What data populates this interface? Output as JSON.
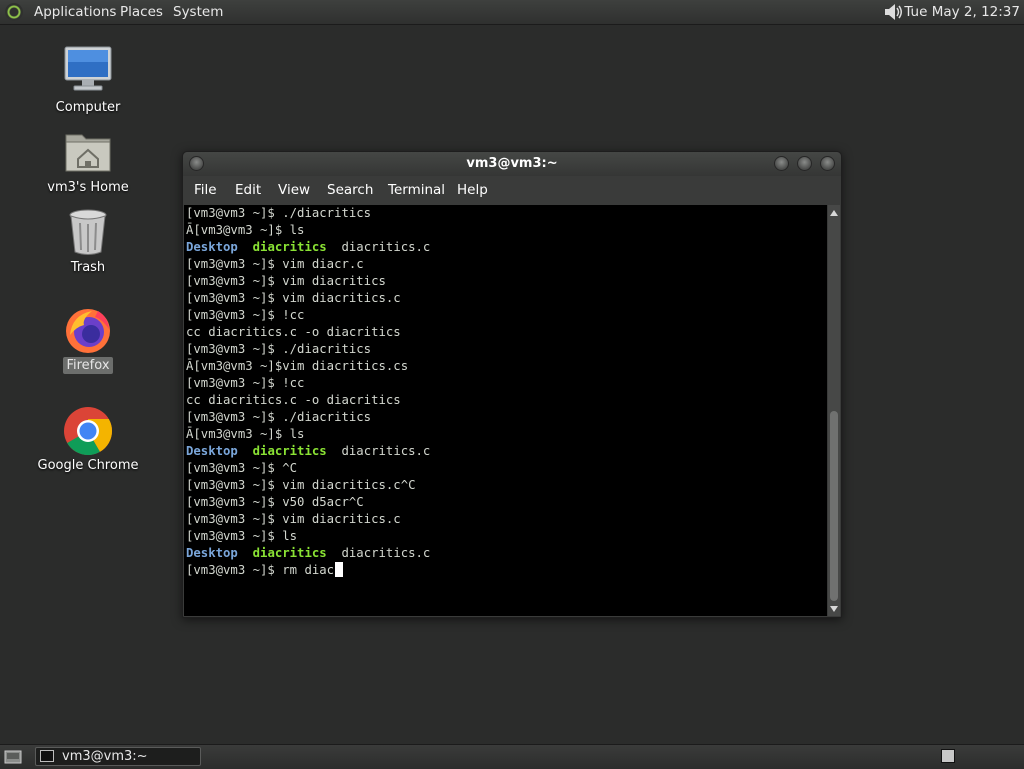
{
  "top_panel": {
    "menus": [
      "Applications",
      "Places",
      "System"
    ],
    "clock": "Tue May  2, 12:37",
    "volume_icon": "speaker-icon",
    "logo_icon": "mate-logo-icon"
  },
  "desktop_icons": [
    {
      "label": "Computer",
      "icon": "computer-icon"
    },
    {
      "label": "vm3's Home",
      "icon": "home-folder-icon"
    },
    {
      "label": "Trash",
      "icon": "trash-icon"
    },
    {
      "label": "Firefox",
      "icon": "firefox-icon",
      "selected": true
    },
    {
      "label": "Google Chrome",
      "icon": "chrome-icon"
    }
  ],
  "terminal": {
    "title": "vm3@vm3:~",
    "menu": [
      "File",
      "Edit",
      "View",
      "Search",
      "Terminal",
      "Help"
    ],
    "lines": [
      [
        {
          "t": "[vm3@vm3 ~]$ ./diacritics"
        }
      ],
      [
        {
          "t": "Ā[vm3@vm3 ~]$ ls"
        }
      ],
      [
        {
          "t": "Desktop",
          "c": "blue"
        },
        {
          "t": "  "
        },
        {
          "t": "diacritics",
          "c": "green"
        },
        {
          "t": "  diacritics.c"
        }
      ],
      [
        {
          "t": "[vm3@vm3 ~]$ vim diacr.c"
        }
      ],
      [
        {
          "t": "[vm3@vm3 ~]$ vim diacritics"
        }
      ],
      [
        {
          "t": "[vm3@vm3 ~]$ vim diacritics.c"
        }
      ],
      [
        {
          "t": "[vm3@vm3 ~]$ !cc"
        }
      ],
      [
        {
          "t": "cc diacritics.c -o diacritics"
        }
      ],
      [
        {
          "t": "[vm3@vm3 ~]$ ./diacritics"
        }
      ],
      [
        {
          "t": "Ā[vm3@vm3 ~]$vim diacritics.cs"
        }
      ],
      [
        {
          "t": "[vm3@vm3 ~]$ !cc"
        }
      ],
      [
        {
          "t": "cc diacritics.c -o diacritics"
        }
      ],
      [
        {
          "t": "[vm3@vm3 ~]$ ./diacritics"
        }
      ],
      [
        {
          "t": "Ā[vm3@vm3 ~]$ ls"
        }
      ],
      [
        {
          "t": "Desktop",
          "c": "blue"
        },
        {
          "t": "  "
        },
        {
          "t": "diacritics",
          "c": "green"
        },
        {
          "t": "  diacritics.c"
        }
      ],
      [
        {
          "t": "[vm3@vm3 ~]$ ^C"
        }
      ],
      [
        {
          "t": "[vm3@vm3 ~]$ vim diacritics.c^C"
        }
      ],
      [
        {
          "t": "[vm3@vm3 ~]$ v50 d5acr^C"
        }
      ],
      [
        {
          "t": "[vm3@vm3 ~]$ vim diacritics.c"
        }
      ],
      [
        {
          "t": "[vm3@vm3 ~]$ ls"
        }
      ],
      [
        {
          "t": "Desktop",
          "c": "blue"
        },
        {
          "t": "  "
        },
        {
          "t": "diacritics",
          "c": "green"
        },
        {
          "t": "  diacritics.c"
        }
      ],
      [
        {
          "t": "[vm3@vm3 ~]$ rm diac"
        }
      ]
    ],
    "colors": {
      "blue": "#7aa6da",
      "green": "#8ae234",
      "foreground": "#d3d7cf",
      "background": "#000000"
    }
  },
  "bottom_panel": {
    "task": "vm3@vm3:~",
    "task_icon": "terminal-icon",
    "show_desktop_icon": "show-desktop-icon",
    "workspace_icon": "workspace-switcher-icon"
  }
}
